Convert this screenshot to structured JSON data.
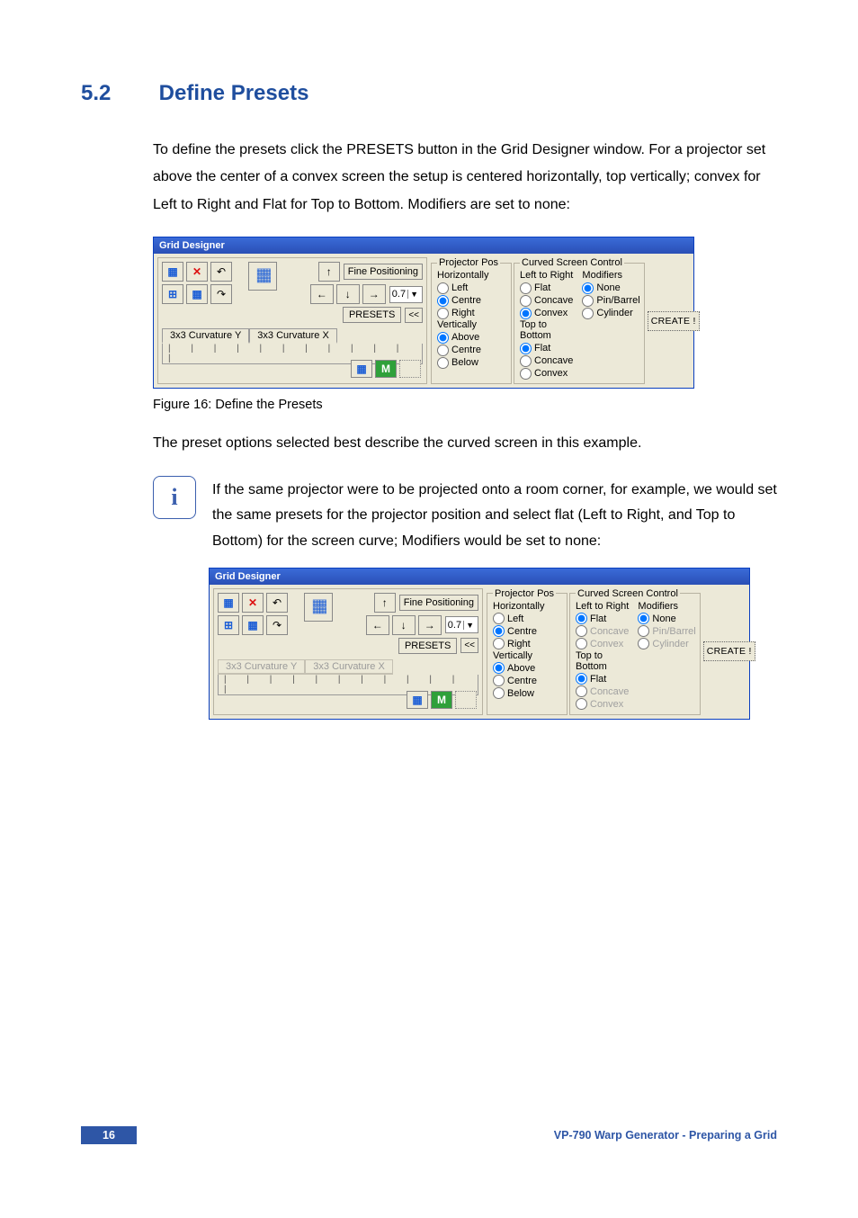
{
  "heading": {
    "number": "5.2",
    "title": "Define Presets"
  },
  "intro": "To define the presets click the PRESETS button in the Grid Designer window. For a projector set above the center of a convex screen the setup is centered horizontally, top vertically; convex for Left to Right and Flat for Top to Bottom. Modifiers are set to none:",
  "figure1_caption": "Figure 16: Define the Presets",
  "after_fig": "The preset options selected best describe the curved screen in this example.",
  "note": "If the same projector were to be projected onto a room corner, for example, we would set the same presets for the projector position and select flat (Left to Right, and Top to Bottom) for the screen curve; Modifiers would be set to none:",
  "gd": {
    "title": "Grid Designer",
    "fine_positioning": "Fine Positioning",
    "step_value": "0.7",
    "presets_btn": "PRESETS",
    "chevron": "<<",
    "tab_y": "3x3 Curvature Y",
    "tab_x": "3x3 Curvature X",
    "create": "CREATE !",
    "projector_pos": {
      "legend": "Projector Pos",
      "h_label": "Horizontally",
      "h": {
        "left": "Left",
        "centre": "Centre",
        "right": "Right"
      },
      "v_label": "Vertically",
      "v": {
        "above": "Above",
        "centre": "Centre",
        "below": "Below"
      }
    },
    "curved": {
      "legend": "Curved Screen Control",
      "lr_label": "Left to Right",
      "lr": {
        "flat": "Flat",
        "concave": "Concave",
        "convex": "Convex"
      },
      "tb_label": "Top to Bottom",
      "tb": {
        "flat": "Flat",
        "concave": "Concave",
        "convex": "Convex"
      },
      "mod_label": "Modifiers",
      "mod": {
        "none": "None",
        "pinbarrel": "Pin/Barrel",
        "cylinder": "Cylinder"
      }
    }
  },
  "panel1": {
    "lr_selected": "convex",
    "tb_selected": "flat",
    "h_selected": "centre",
    "v_selected": "above",
    "mod_selected": "none",
    "tabs_active": true
  },
  "panel2": {
    "lr_selected": "flat",
    "tb_selected": "flat",
    "h_selected": "centre",
    "v_selected": "above",
    "mod_selected": "none",
    "tabs_active": false
  },
  "footer": {
    "page": "16",
    "doc": "VP-790 Warp Generator - Preparing a Grid"
  }
}
